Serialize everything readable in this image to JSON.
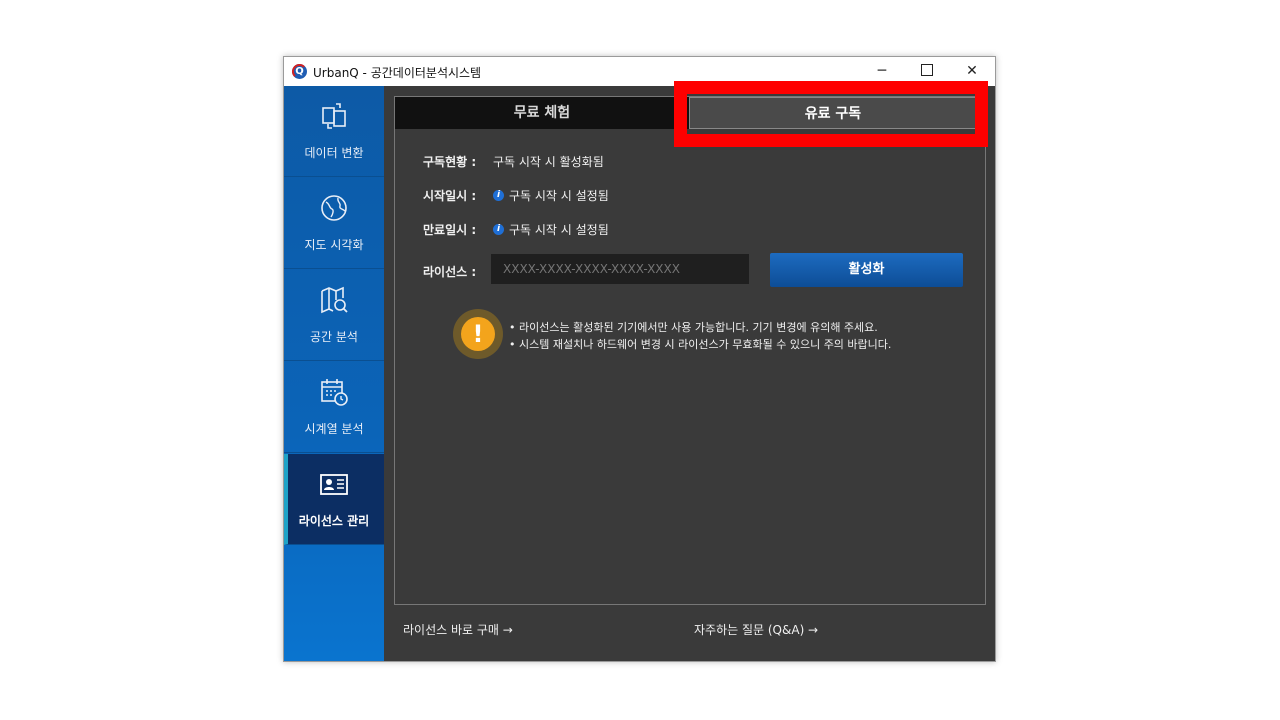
{
  "window": {
    "title": "UrbanQ - 공간데이터분석시스템",
    "logo_letter": "Q",
    "min_glyph": "─",
    "close_glyph": "✕"
  },
  "sidebar": {
    "items": [
      {
        "label": "데이터 변환",
        "icon": "data-convert-icon"
      },
      {
        "label": "지도 시각화",
        "icon": "globe-icon"
      },
      {
        "label": "공간 분석",
        "icon": "map-search-icon"
      },
      {
        "label": "시계열 분석",
        "icon": "calendar-clock-icon"
      },
      {
        "label": "라이선스 관리",
        "icon": "id-card-icon",
        "active": true
      }
    ]
  },
  "tabs": {
    "free": "무료 체험",
    "paid": "유료 구독"
  },
  "subscription": {
    "status_label": "구독현황 :",
    "status_value": "구독 시작 시 활성화됨",
    "start_label": "시작일시 :",
    "start_value": "구독 시작 시 설정됨",
    "end_label": "만료일시 :",
    "end_value": "구독 시작 시 설정됨",
    "license_label": "라이선스 :",
    "license_placeholder": "XXXX-XXXX-XXXX-XXXX-XXXX",
    "activate_label": "활성화"
  },
  "notice": {
    "line1": "• 라이선스는 활성화된 기기에서만 사용 가능합니다. 기기 변경에 유의해 주세요.",
    "line2": "• 시스템 재설치나 하드웨어 변경 시 라이선스가 무효화될 수 있으니 주의 바랍니다."
  },
  "footer": {
    "buy_link": "라이선스 바로 구매 →",
    "faq_link": "자주하는 질문 (Q&A) →"
  },
  "colors": {
    "highlight": "#ff0000",
    "sidebar": "#0b64b8",
    "active_item": "#0c2e63",
    "accent_button": "#1d6bc0",
    "warning": "#f3a41c"
  }
}
